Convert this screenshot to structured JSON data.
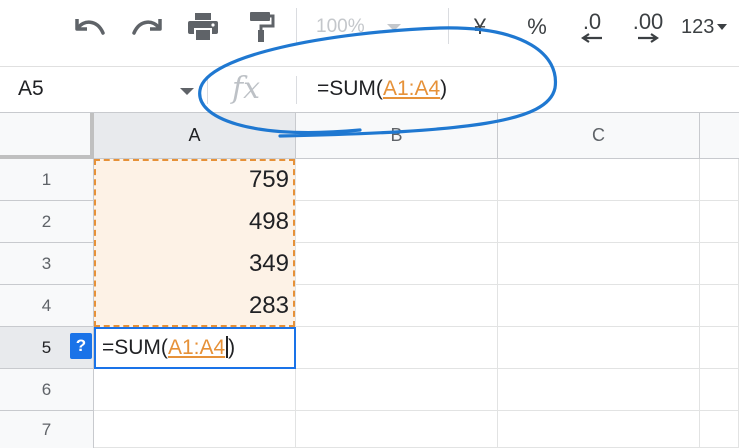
{
  "toolbar": {
    "zoom": "100%",
    "currency": "¥",
    "percent": "%",
    "decrease_decimal": ".0",
    "increase_decimal": ".00",
    "more_formats": "123"
  },
  "formula_bar": {
    "name_box": "A5",
    "fx_label": "fx",
    "formula_prefix": "=SUM(",
    "formula_range": "A1:A4",
    "formula_suffix": ")"
  },
  "columns": [
    "A",
    "B",
    "C"
  ],
  "rows": [
    "1",
    "2",
    "3",
    "4",
    "5",
    "6",
    "7"
  ],
  "cells": {
    "A1": "759",
    "A2": "498",
    "A3": "349",
    "A4": "283"
  },
  "editor": {
    "prefix": "=SUM(",
    "range": "A1:A4",
    "suffix": ")",
    "help_label": "?"
  },
  "colors": {
    "accent_blue": "#1a73e8",
    "range_orange": "#e69138",
    "annotation_blue": "#1f78d1"
  }
}
